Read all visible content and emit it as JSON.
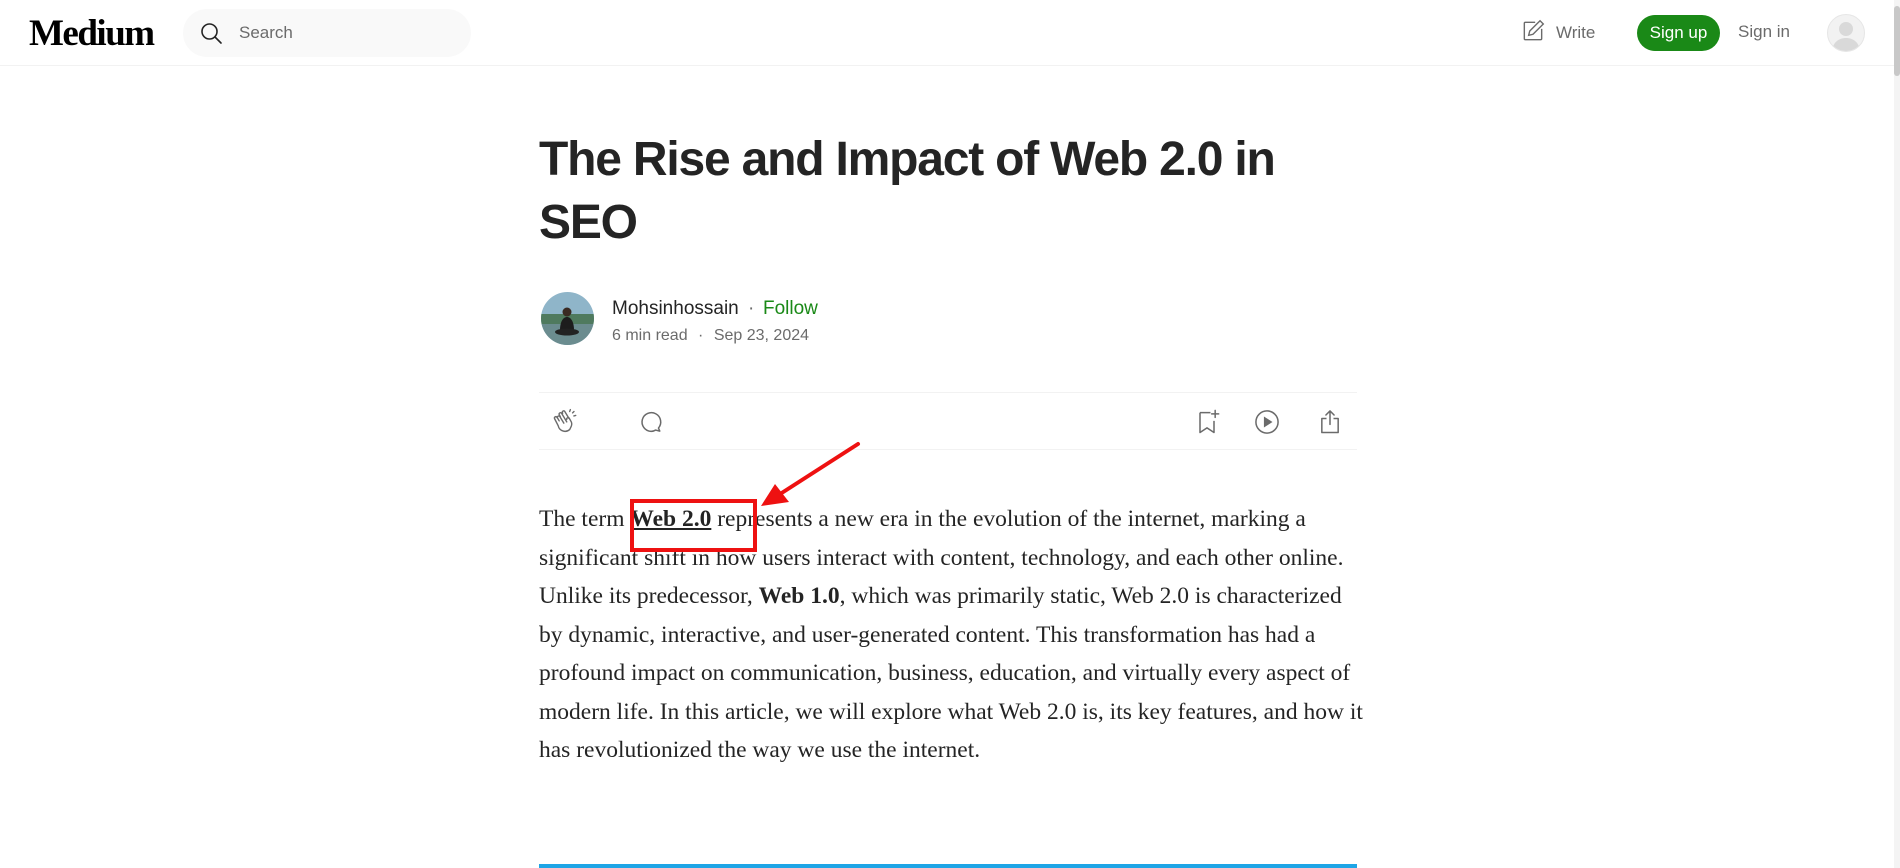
{
  "nav": {
    "logo": "Medium",
    "search_placeholder": "Search",
    "write_label": "Write",
    "signup_label": "Sign up",
    "signin_label": "Sign in"
  },
  "article": {
    "title": "The Rise and Impact of Web 2.0 in SEO",
    "author": "Mohsinhossain",
    "separator": "·",
    "follow_label": "Follow",
    "read_time": "6 min read",
    "date": "Sep 23, 2024",
    "paragraph": {
      "t1": "The term ",
      "link": "Web 2.0",
      "t2": " represents a new era in the evolution of the internet, marking a significant shift in how users interact with content, technology, and each other online. Unlike its predecessor, ",
      "bold": "Web 1.0",
      "t3": ", which was primarily static, Web 2.0 is characterized by dynamic, interactive, and user-generated content. This transformation has had a profound impact on communication, business, education, and virtually every aspect of modern life. In this article, we will explore what Web 2.0 is, its key features, and how it has revolutionized the way we use the internet."
    }
  },
  "icons": {
    "search": "search-icon",
    "write": "pencil-square-icon",
    "clap": "clap-icon",
    "comment": "comment-bubble-icon",
    "bookmark": "bookmark-add-icon",
    "listen": "play-circle-icon",
    "share": "share-icon"
  },
  "colors": {
    "brand_green": "#1a8917",
    "annotation_red": "#ee1111",
    "divider_blue": "#1ea5e6"
  }
}
